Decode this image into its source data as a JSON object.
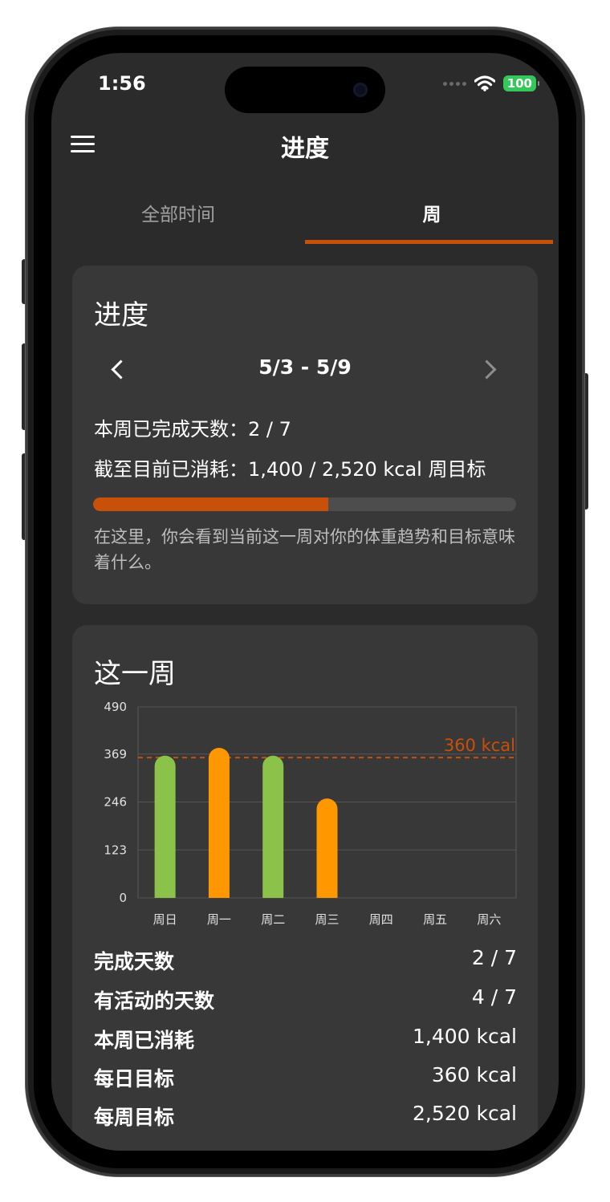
{
  "status_bar": {
    "time": "1:56",
    "battery": "100"
  },
  "nav": {
    "title": "进度"
  },
  "tabs": [
    {
      "label": "全部时间",
      "selected": false
    },
    {
      "label": "周",
      "selected": true
    }
  ],
  "progress_card": {
    "title": "进度",
    "week_range": "5/3 - 5/9",
    "days_completed_line": "本周已完成天数：2 / 7",
    "consumed_line": "截至目前已消耗：1,400 / 2,520 kcal 周目标",
    "progress_fraction": 0.556,
    "description": "在这里，你会看到当前这一周对你的体重趋势和目标意味着什么。"
  },
  "week_card": {
    "title": "这一周",
    "stats": [
      {
        "label": "完成天数",
        "value": "2 / 7"
      },
      {
        "label": "有活动的天数",
        "value": "4 / 7"
      },
      {
        "label": "本周已消耗",
        "value": "1,400 kcal"
      },
      {
        "label": "每日目标",
        "value": "360 kcal"
      },
      {
        "label": "每周目标",
        "value": "2,520 kcal"
      }
    ]
  },
  "colors": {
    "accent": "#c95008",
    "goal_met": "#8bc34a",
    "goal_missed": "#ff9800",
    "goal_line": "#c95008"
  },
  "chart_data": {
    "type": "bar",
    "categories": [
      "周日",
      "周一",
      "周二",
      "周三",
      "周四",
      "周五",
      "周六"
    ],
    "values": [
      365,
      385,
      365,
      255,
      null,
      null,
      null
    ],
    "status": [
      "met",
      "missed",
      "met",
      "missed",
      null,
      null,
      null
    ],
    "y_ticks": [
      "0",
      "123",
      "246",
      "369",
      "490"
    ],
    "ylim": [
      0,
      490
    ],
    "goal": {
      "value": 360,
      "label": "360 kcal"
    },
    "grid": true
  }
}
